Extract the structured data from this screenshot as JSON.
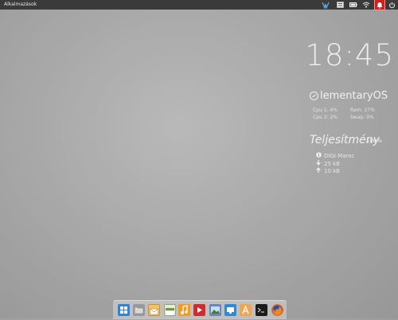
{
  "panel": {
    "applications_label": "Alkalmazások",
    "indicators": [
      {
        "name": "network-indicator",
        "icon": "network-icon"
      },
      {
        "name": "keyboard-indicator",
        "icon": "keyboard-icon"
      },
      {
        "name": "battery-indicator",
        "icon": "battery-icon"
      },
      {
        "name": "wifi-indicator",
        "icon": "wifi-icon"
      },
      {
        "name": "notifications-indicator",
        "icon": "notification-icon"
      },
      {
        "name": "power-indicator",
        "icon": "power-icon"
      }
    ],
    "notify_color": "#cf1f1f"
  },
  "conky": {
    "clock": "18:45",
    "system_title": "lementaryOS",
    "cpu1": "Cpu 1: 4%",
    "cpu2": "Cpu 2: 2%",
    "ram": "Ram: 27%",
    "swap": "Swap: 0%",
    "perf_title": "Teljesítmény",
    "perf_value": "100%",
    "net_name": "DIGI Maroc",
    "net_down": "25 kB",
    "net_up": "10 kB"
  },
  "dock": {
    "items": [
      {
        "name": "multitasking-view",
        "icon": "grid-icon"
      },
      {
        "name": "files",
        "icon": "folder-icon"
      },
      {
        "name": "mail",
        "icon": "mail-icon"
      },
      {
        "name": "calendar",
        "icon": "calendar-icon"
      },
      {
        "name": "music",
        "icon": "music-icon"
      },
      {
        "name": "videos",
        "icon": "video-icon"
      },
      {
        "name": "photos",
        "icon": "photos-icon"
      },
      {
        "name": "software-center",
        "icon": "store-icon"
      },
      {
        "name": "app-store",
        "icon": "package-icon"
      },
      {
        "name": "terminal",
        "icon": "terminal-icon"
      },
      {
        "name": "firefox",
        "icon": "firefox-icon"
      }
    ]
  }
}
